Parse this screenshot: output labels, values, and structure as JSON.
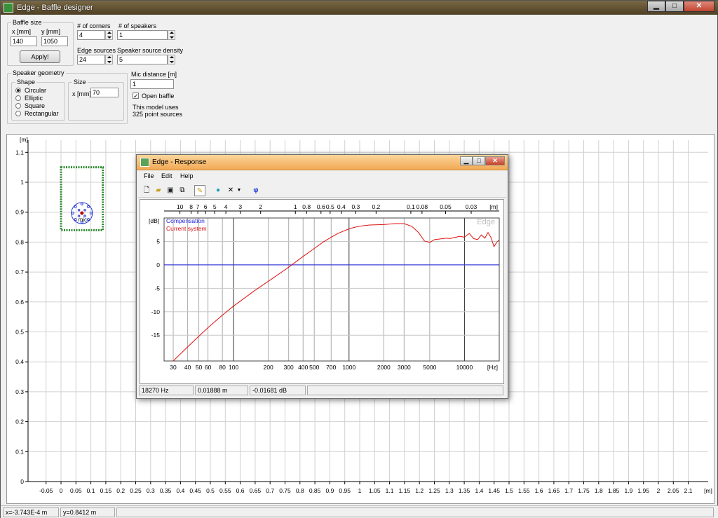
{
  "window": {
    "title": "Edge - Baffle designer",
    "controls": {
      "minimize": "▁",
      "maximize": "□",
      "close": "✕"
    }
  },
  "baffle_size": {
    "label": "Baffle size",
    "x_label": "x [mm]",
    "y_label": "y [mm]",
    "x_value": "140",
    "y_value": "1050",
    "apply": "Apply!"
  },
  "corners": {
    "label": "# of corners",
    "value": "4"
  },
  "speakers": {
    "label": "# of speakers",
    "value": "1"
  },
  "edge_sources": {
    "label": "Edge sources",
    "value": "24"
  },
  "speaker_density": {
    "label": "Speaker source density",
    "value": "5"
  },
  "geometry": {
    "label": "Speaker geometry",
    "shape_label": "Shape",
    "shapes": [
      "Circular",
      "Elliptic",
      "Square",
      "Rectangular"
    ],
    "selected": 0,
    "size_label": "Size",
    "x_label": "x [mm]",
    "x_value": "70"
  },
  "mic": {
    "label": "Mic distance [m]",
    "value": "1",
    "open_baffle_label": "Open baffle",
    "open_baffle_checked": true,
    "info_line1": "This model uses",
    "info_line2": "325 point sources"
  },
  "main_plot": {
    "y_unit": "[m]",
    "y_ticks": [
      "1.1",
      "1",
      "0.9",
      "0.8",
      "0.7",
      "0.6",
      "0.5",
      "0.4",
      "0.3",
      "0.2",
      "0.1",
      "0"
    ],
    "x_unit": "[m]",
    "x_ticks": [
      "-0.05",
      "0",
      "0.05",
      "0.1",
      "0.15",
      "0.2",
      "0.25",
      "0.3",
      "0.35",
      "0.4",
      "0.45",
      "0.5",
      "0.55",
      "0.6",
      "0.65",
      "0.7",
      "0.75",
      "0.8",
      "0.85",
      "0.9",
      "0.95",
      "1",
      "1.05",
      "1.1",
      "1.15",
      "1.2",
      "1.25",
      "1.3",
      "1.35",
      "1.4",
      "1.45",
      "1.5",
      "1.55",
      "1.6",
      "1.65",
      "1.7",
      "1.75",
      "1.8",
      "1.85",
      "1.9",
      "1.95",
      "2",
      "2.05",
      "2.1"
    ],
    "mic_label": "mic",
    "baffle_color": "#2e8b2e",
    "speaker_color": "#2b3bd1",
    "mic_color": "#c00000"
  },
  "status": {
    "x": "x=-3.743E-4 m",
    "y": "y=0.8412 m"
  },
  "response": {
    "title": "Edge - Response",
    "menus": [
      "File",
      "Edit",
      "Help"
    ],
    "toolbar_icons": [
      "new-icon",
      "open-icon",
      "save-icon",
      "copy-icon",
      "pen-icon",
      "sphere-icon",
      "cross-icon",
      "dropdown-icon",
      "phi-icon"
    ],
    "watermark": "Edge",
    "status": {
      "freq": "18270 Hz",
      "dist": "0.01888 m",
      "db": "-0.01681 dB"
    }
  },
  "chart_data": {
    "type": "line",
    "ylabel": "[dB]",
    "xlabel": "[Hz]",
    "x_scale": "log",
    "xlim": [
      25,
      20000
    ],
    "ylim": [
      -20.5,
      10
    ],
    "y_ticks": [
      "5",
      "0",
      "-5",
      "-10",
      "-15"
    ],
    "y_tick_values": [
      5,
      0,
      -5,
      -10,
      -15
    ],
    "x_ticks": [
      "30",
      "40",
      "50",
      "60",
      "80",
      "100",
      "200",
      "300",
      "400",
      "500",
      "700",
      "1000",
      "2000",
      "3000",
      "5000",
      "10000"
    ],
    "x_tick_values": [
      30,
      40,
      50,
      60,
      80,
      100,
      200,
      300,
      400,
      500,
      700,
      1000,
      2000,
      3000,
      5000,
      10000
    ],
    "top_axis_unit": "[m]",
    "top_ticks": [
      "10",
      "8",
      "7",
      "6",
      "5",
      "4",
      "3",
      "2",
      "1",
      "0.8",
      "0.6",
      "0.5",
      "0.4",
      "0.3",
      "0.2",
      "0.1",
      "0.08",
      "0.05",
      "0.03"
    ],
    "top_tick_values": [
      10,
      8,
      7,
      6,
      5,
      4,
      3,
      2,
      1,
      0.8,
      0.6,
      0.5,
      0.4,
      0.3,
      0.2,
      0.1,
      0.08,
      0.05,
      0.03
    ],
    "grid": true,
    "legend_position": "top-left",
    "series": [
      {
        "name": "Compensation",
        "color": "#1a1adb",
        "x": [
          25,
          20000
        ],
        "y": [
          0,
          0
        ]
      },
      {
        "name": "Current system",
        "color": "#e01010",
        "x": [
          30,
          40,
          50,
          60,
          80,
          100,
          150,
          200,
          300,
          400,
          500,
          600,
          700,
          800,
          1000,
          1200,
          1500,
          2000,
          2500,
          3000,
          3500,
          4000,
          4500,
          5000,
          5500,
          6000,
          6500,
          7000,
          7500,
          8000,
          8500,
          9000,
          9500,
          10000,
          11000,
          12000,
          13000,
          14000,
          15000,
          16000,
          17000,
          18000,
          19000,
          20000
        ],
        "y": [
          -20.5,
          -17.5,
          -15.2,
          -13.4,
          -10.7,
          -8.8,
          -5.6,
          -3.5,
          -0.5,
          1.8,
          3.5,
          4.9,
          5.9,
          6.7,
          7.7,
          8.2,
          8.5,
          8.6,
          8.8,
          8.8,
          8.2,
          6.9,
          5.1,
          4.8,
          5.4,
          5.5,
          5.6,
          5.7,
          5.6,
          5.8,
          5.9,
          6.1,
          6.0,
          5.9,
          6.7,
          5.6,
          5.4,
          6.4,
          5.7,
          6.9,
          5.8,
          3.9,
          4.8,
          5.3
        ]
      }
    ]
  }
}
